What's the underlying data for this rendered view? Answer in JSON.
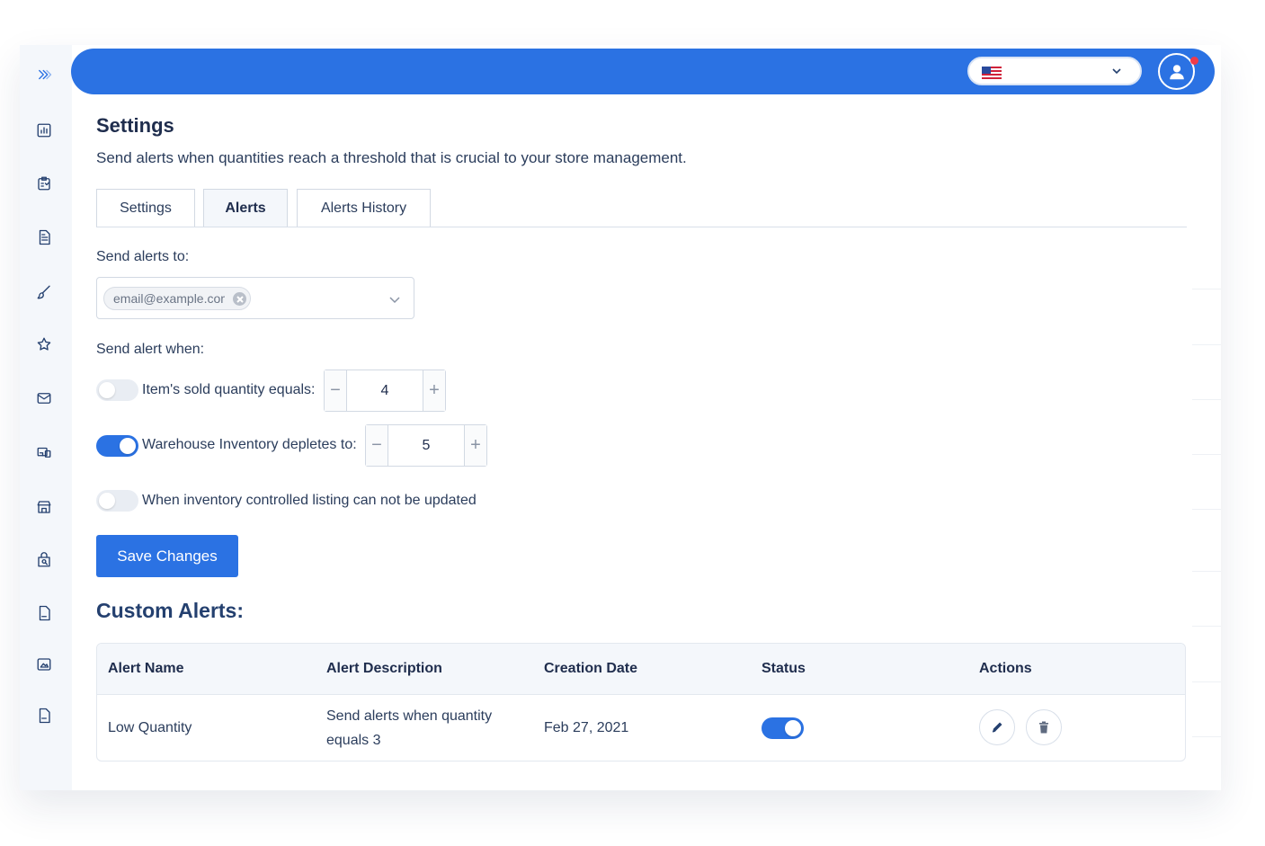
{
  "colors": {
    "brand": "#2b72e3",
    "notification": "#ef3b4a"
  },
  "sidebar": {
    "items": [
      {
        "icon": "expand-chevrons-icon"
      },
      {
        "icon": "bar-chart-icon"
      },
      {
        "icon": "clipboard-icon"
      },
      {
        "icon": "document-icon"
      },
      {
        "icon": "brush-icon"
      },
      {
        "icon": "star-icon"
      },
      {
        "icon": "mail-icon"
      },
      {
        "icon": "devices-icon"
      },
      {
        "icon": "store-icon"
      },
      {
        "icon": "bag-search-icon"
      },
      {
        "icon": "pdf-file-icon"
      },
      {
        "icon": "image-icon"
      },
      {
        "icon": "csv-file-icon"
      }
    ]
  },
  "header": {
    "language_icon": "us-flag-icon",
    "language_label": ""
  },
  "page": {
    "title": "Settings",
    "subtitle": "Send alerts when quantities reach a threshold that is crucial to your store management."
  },
  "tabs": [
    {
      "label": "Settings",
      "active": false
    },
    {
      "label": "Alerts",
      "active": true
    },
    {
      "label": "Alerts History",
      "active": false
    }
  ],
  "form": {
    "send_to_label": "Send alerts to:",
    "email_chip": "email@example.com",
    "send_when_label": "Send alert when:",
    "conditions": [
      {
        "label": "Item's sold quantity equals:",
        "enabled": false,
        "value": "4"
      },
      {
        "label": "Warehouse Inventory depletes to:",
        "enabled": true,
        "value": "5"
      },
      {
        "label": "When inventory controlled listing can not be updated",
        "enabled": false
      }
    ],
    "save_label": "Save Changes"
  },
  "custom_alerts": {
    "title": "Custom Alerts:",
    "columns": [
      "Alert Name",
      "Alert Description",
      "Creation Date",
      "Status",
      "Actions"
    ],
    "rows": [
      {
        "name": "Low Quantity",
        "description_line1": "Send alerts when quantity",
        "description_line2": "equals 3",
        "date": "Feb 27, 2021",
        "status_on": true
      }
    ]
  }
}
